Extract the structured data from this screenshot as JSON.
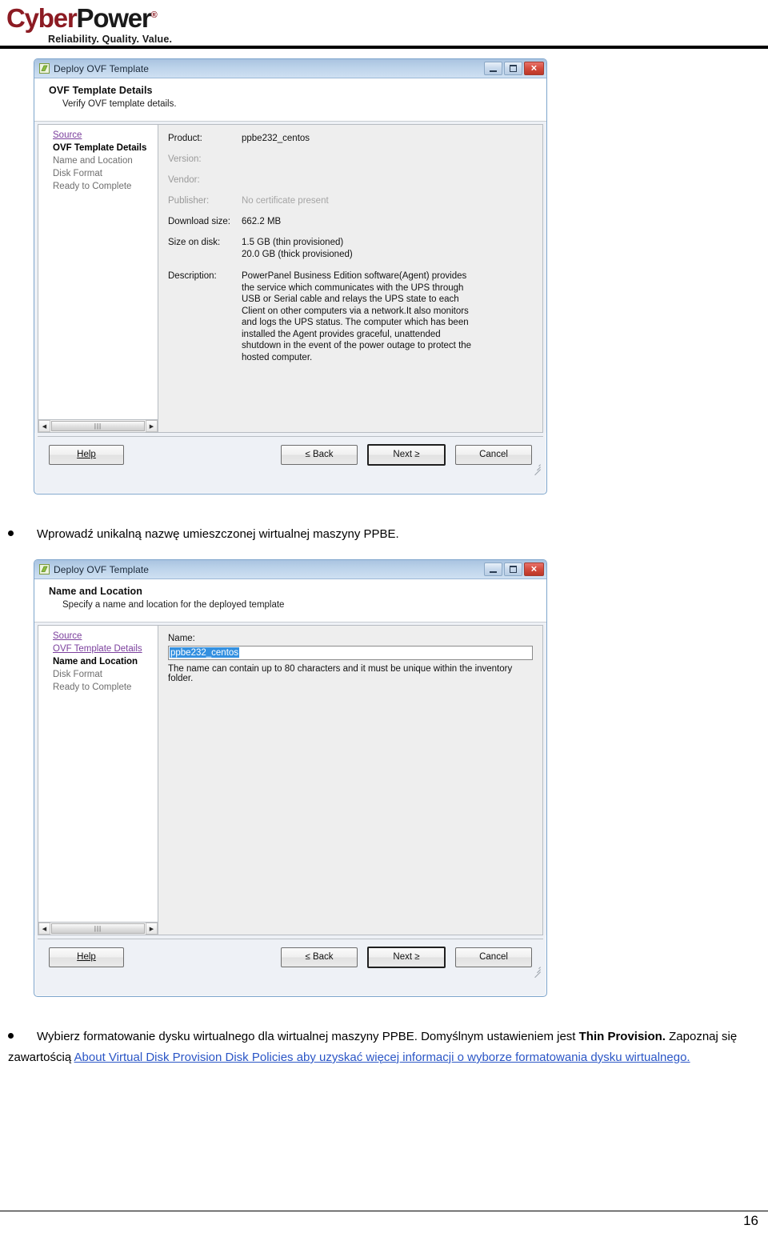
{
  "brand": {
    "name_part1": "Cyber",
    "name_part2": "Power",
    "registered": "®",
    "tagline": "Reliability. Quality. Value."
  },
  "colors": {
    "brand_red": "#8c1b23",
    "brand_black": "#1a1a1a",
    "titlebar_blue": "#a9c3e0",
    "link_purple": "#7b3f9d",
    "link_blue": "#2b56c6",
    "selection_blue": "#3390e0",
    "close_button_red": "#d34b3d"
  },
  "dialog1": {
    "icon": "ovf-template-icon",
    "title": "Deploy OVF Template",
    "window_buttons": {
      "minimize": "minimize-icon",
      "maximize": "maximize-icon",
      "close": "✕"
    },
    "head_title": "OVF Template Details",
    "head_sub": "Verify OVF template details.",
    "sidebar": [
      {
        "label": "Source",
        "state": "link"
      },
      {
        "label": "OVF Template Details",
        "state": "current"
      },
      {
        "label": "Name and Location",
        "state": "pending"
      },
      {
        "label": "Disk Format",
        "state": "pending"
      },
      {
        "label": "Ready to Complete",
        "state": "pending"
      }
    ],
    "details": [
      {
        "label": "Product:",
        "label_muted": false,
        "value": "ppbe232_centos",
        "value_muted": false
      },
      {
        "label": "Version:",
        "label_muted": true,
        "value": "",
        "value_muted": true
      },
      {
        "label": "Vendor:",
        "label_muted": true,
        "value": "",
        "value_muted": true
      },
      {
        "label": "Publisher:",
        "label_muted": true,
        "value": "No certificate present",
        "value_muted": true
      },
      {
        "label": "Download size:",
        "label_muted": false,
        "value": "662.2 MB",
        "value_muted": false
      }
    ],
    "size_on_disk": {
      "label": "Size on disk:",
      "line1": "1.5 GB (thin provisioned)",
      "line2": "20.0 GB (thick provisioned)"
    },
    "description": {
      "label": "Description:",
      "text": "PowerPanel Business Edition software(Agent) provides the service which communicates with the UPS through USB or Serial cable and relays the UPS state to each Client on other computers via a network.It also monitors and logs the UPS status. The computer which has been installed the Agent provides graceful, unattended shutdown in the event of the power outage to protect the hosted computer."
    },
    "buttons": {
      "help": "Help",
      "back": "≤ Back",
      "next": "Next ≥",
      "cancel": "Cancel"
    }
  },
  "bullet1": {
    "text": "Wprowadź unikalną nazwę umieszczonej wirtualnej maszyny PPBE."
  },
  "dialog2": {
    "icon": "ovf-template-icon",
    "title": "Deploy OVF Template",
    "window_buttons": {
      "minimize": "minimize-icon",
      "maximize": "maximize-icon",
      "close": "✕"
    },
    "head_title": "Name and Location",
    "head_sub": "Specify a name and location for the deployed template",
    "sidebar": [
      {
        "label": "Source",
        "state": "link"
      },
      {
        "label": "OVF Template Details",
        "state": "link"
      },
      {
        "label": "Name and Location",
        "state": "current"
      },
      {
        "label": "Disk Format",
        "state": "pending"
      },
      {
        "label": "Ready to Complete",
        "state": "pending"
      }
    ],
    "name_field": {
      "label": "Name:",
      "value": "ppbe232_centos",
      "placeholder": "",
      "hint": "The name can contain up to 80 characters and it must be unique within the inventory folder."
    },
    "buttons": {
      "help": "Help",
      "back": "≤ Back",
      "next": "Next ≥",
      "cancel": "Cancel"
    }
  },
  "bullet2": {
    "seg1": "Wybierz formatowanie dysku wirtualnego dla wirtualnej maszyny PPBE. Domyślnym ustawieniem jest ",
    "bold": "Thin Provision.",
    "seg2": " Zapoznaj się zawartością ",
    "link": "About Virtual Disk Provision Disk Policies aby uzyskać więcej informacji o wyborze formatowania dysku wirtualnego."
  },
  "page": {
    "number": "16"
  }
}
